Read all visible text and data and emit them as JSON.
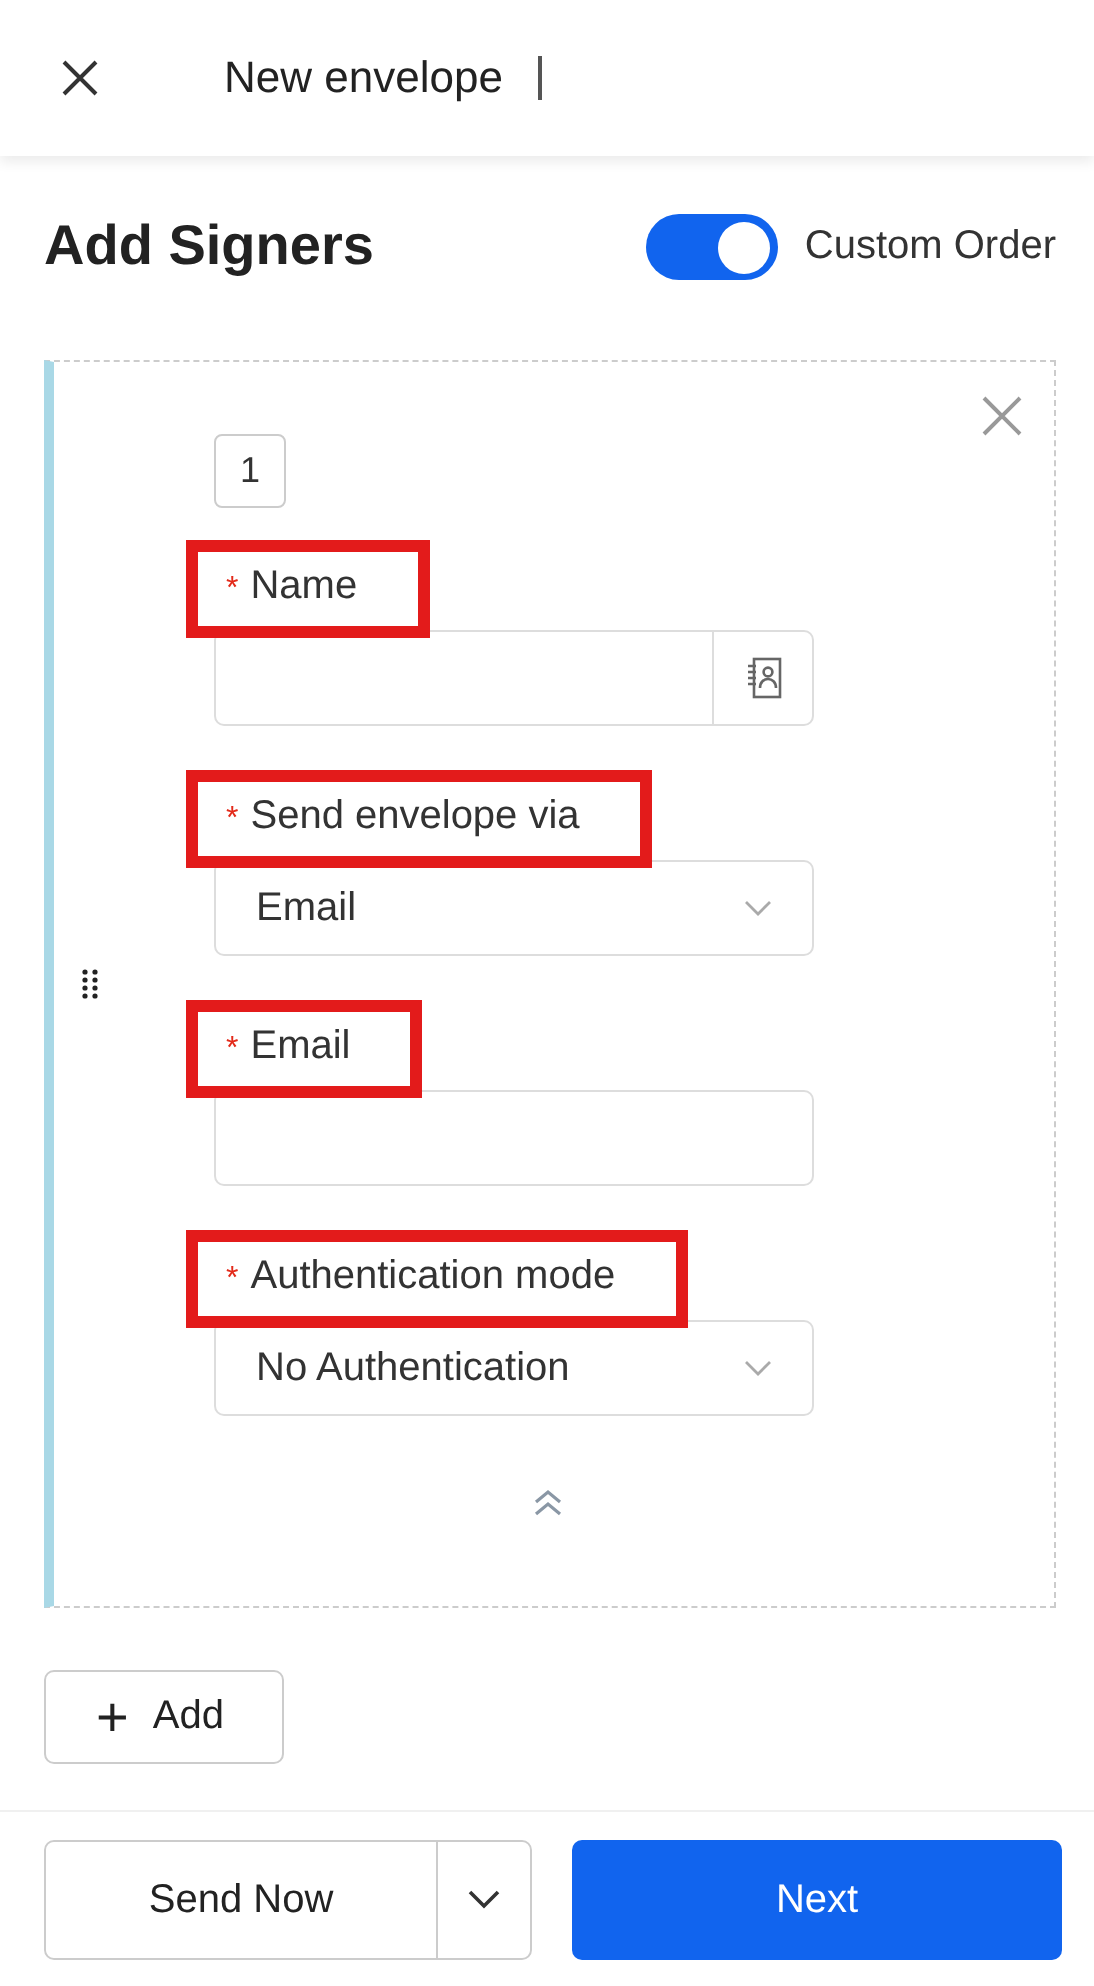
{
  "header": {
    "title": "New envelope"
  },
  "page": {
    "title": "Add Signers",
    "custom_order": {
      "label": "Custom Order",
      "on": true
    }
  },
  "signer": {
    "order": "1",
    "fields": [
      {
        "kind": "contact-input",
        "required_mark": "*",
        "label": "Name",
        "highlighted": true
      },
      {
        "kind": "select",
        "required_mark": "*",
        "label": "Send envelope via",
        "value": "Email",
        "highlighted": true
      },
      {
        "kind": "input",
        "required_mark": "*",
        "label": "Email",
        "highlighted": true
      },
      {
        "kind": "select",
        "required_mark": "*",
        "label": "Authentication mode",
        "value": "No Authentication",
        "highlighted": true
      }
    ]
  },
  "add_button": {
    "symbol": "+",
    "label": "Add"
  },
  "footer": {
    "send_button": "Send Now",
    "next_button": "Next"
  }
}
